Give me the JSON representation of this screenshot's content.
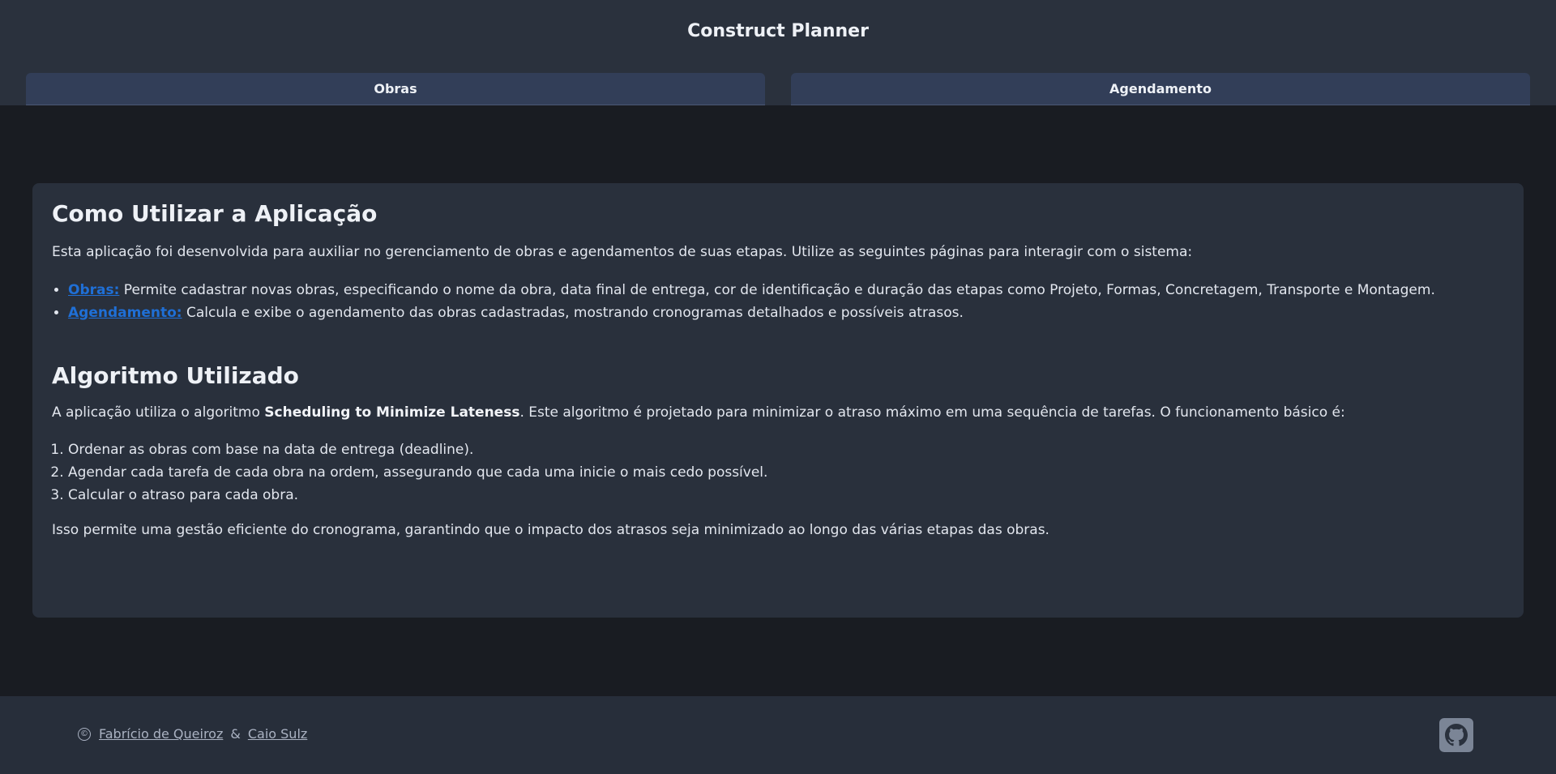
{
  "header": {
    "title": "Construct Planner",
    "tabs": [
      {
        "label": "Obras"
      },
      {
        "label": "Agendamento"
      }
    ]
  },
  "main": {
    "usage_heading": "Como Utilizar a Aplicação",
    "usage_intro": "Esta aplicação foi desenvolvida para auxiliar no gerenciamento de obras e agendamentos de suas etapas. Utilize as seguintes páginas para interagir com o sistema:",
    "pages": [
      {
        "link": "Obras:",
        "text": " Permite cadastrar novas obras, especificando o nome da obra, data final de entrega, cor de identificação e duração das etapas como Projeto, Formas, Concretagem, Transporte e Montagem."
      },
      {
        "link": "Agendamento:",
        "text": " Calcula e exibe o agendamento das obras cadastradas, mostrando cronogramas detalhados e possíveis atrasos."
      }
    ],
    "algo_heading": "Algoritmo Utilizado",
    "algo_intro_before": "A aplicação utiliza o algoritmo ",
    "algo_name": "Scheduling to Minimize Lateness",
    "algo_intro_after": ". Este algoritmo é projetado para minimizar o atraso máximo em uma sequência de tarefas. O funcionamento básico é:",
    "steps": [
      "Ordenar as obras com base na data de entrega (deadline).",
      "Agendar cada tarefa de cada obra na ordem, assegurando que cada uma inicie o mais cedo possível.",
      "Calcular o atraso para cada obra."
    ],
    "outro": "Isso permite uma gestão eficiente do cronograma, garantindo que o impacto dos atrasos seja minimizado ao longo das várias etapas das obras."
  },
  "footer": {
    "copyright_symbol": "©",
    "author1": "Fabrício de Queiroz",
    "separator": "&",
    "author2": "Caio Sulz",
    "github_icon": "github-icon"
  },
  "colors": {
    "header_bg": "#2a313d",
    "tab_bg": "#323e58",
    "page_bg": "#191c22",
    "card_bg": "#29303c",
    "link": "#1f6fd6",
    "footer_bg": "#272e3a"
  }
}
